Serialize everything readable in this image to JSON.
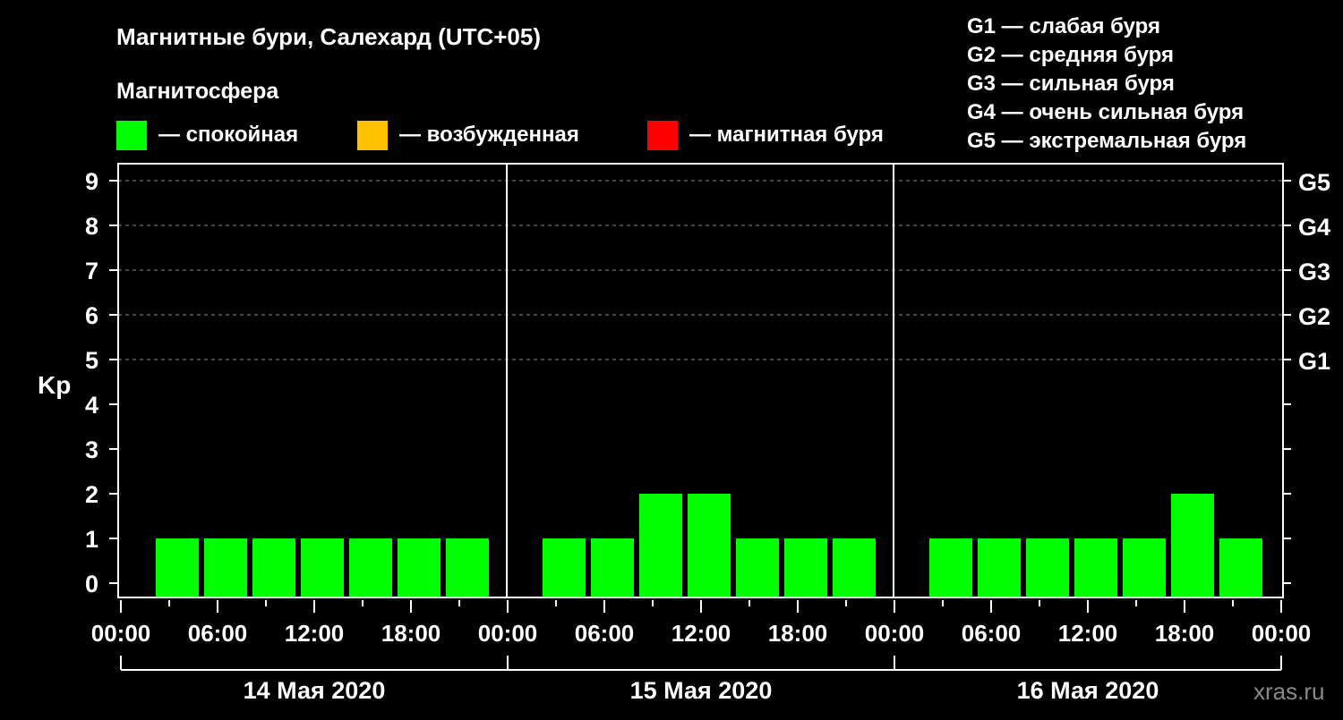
{
  "chart_data": {
    "type": "bar",
    "title": "Магнитные бури, Салехард (UTC+05)",
    "subtitle": "Магнитосфера",
    "ylabel": "Kp",
    "ylim": [
      0,
      9
    ],
    "yticks": [
      "0",
      "1",
      "2",
      "3",
      "4",
      "5",
      "6",
      "7",
      "8",
      "9"
    ],
    "right_ticks": [
      {
        "kp": 5,
        "label": "G1"
      },
      {
        "kp": 6,
        "label": "G2"
      },
      {
        "kp": 7,
        "label": "G3"
      },
      {
        "kp": 8,
        "label": "G4"
      },
      {
        "kp": 9,
        "label": "G5"
      }
    ],
    "xtick_labels": [
      "00:00",
      "06:00",
      "12:00",
      "18:00"
    ],
    "final_xtick": "00:00",
    "grid": true,
    "legend": [
      {
        "label": "— спокойная",
        "color": "#00ff00"
      },
      {
        "label": "— возбужденная",
        "color": "#ffc000"
      },
      {
        "label": "— магнитная буря",
        "color": "#ff0000"
      }
    ],
    "scale_legend": [
      "G1 — слабая буря",
      "G2 — средняя буря",
      "G3 — сильная буря",
      "G4 — очень сильная буря",
      "G5 — экстремальная буря"
    ],
    "days": [
      {
        "label": "14 Мая 2020",
        "values": [
          null,
          1,
          1,
          1,
          1,
          1,
          1,
          1
        ]
      },
      {
        "label": "15 Мая 2020",
        "values": [
          null,
          1,
          1,
          2,
          2,
          1,
          1,
          1
        ]
      },
      {
        "label": "16 Мая 2020",
        "values": [
          null,
          1,
          1,
          1,
          1,
          1,
          2,
          1
        ]
      }
    ]
  },
  "watermark": "xras.ru"
}
